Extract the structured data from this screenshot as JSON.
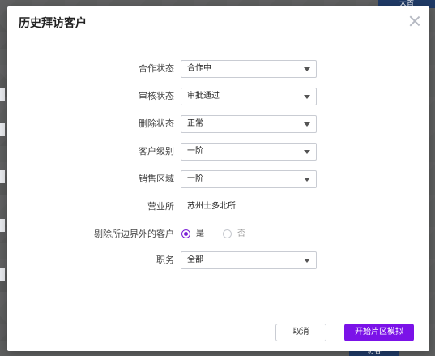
{
  "background": {
    "top_right_label": "大首",
    "bottom_right_label": "访客"
  },
  "dialog": {
    "title": "历史拜访客户",
    "fields": {
      "coop_status": {
        "label": "合作状态",
        "value": "合作中"
      },
      "review_status": {
        "label": "审核状态",
        "value": "审批通过"
      },
      "delete_status": {
        "label": "删除状态",
        "value": "正常"
      },
      "customer_level": {
        "label": "客户级别",
        "value": "一阶"
      },
      "sales_region": {
        "label": "销售区域",
        "value": "一阶"
      },
      "business_office": {
        "label": "营业所",
        "value": "苏州士多北所"
      },
      "exclude_outside": {
        "label": "剔除所边界外的客户",
        "options": [
          "是",
          "否"
        ],
        "selected": "是"
      },
      "position": {
        "label": "职务",
        "value": "全部"
      }
    },
    "buttons": {
      "cancel": "取消",
      "start": "开始片区模拟"
    },
    "colors": {
      "accent": "#7b12e8"
    }
  }
}
